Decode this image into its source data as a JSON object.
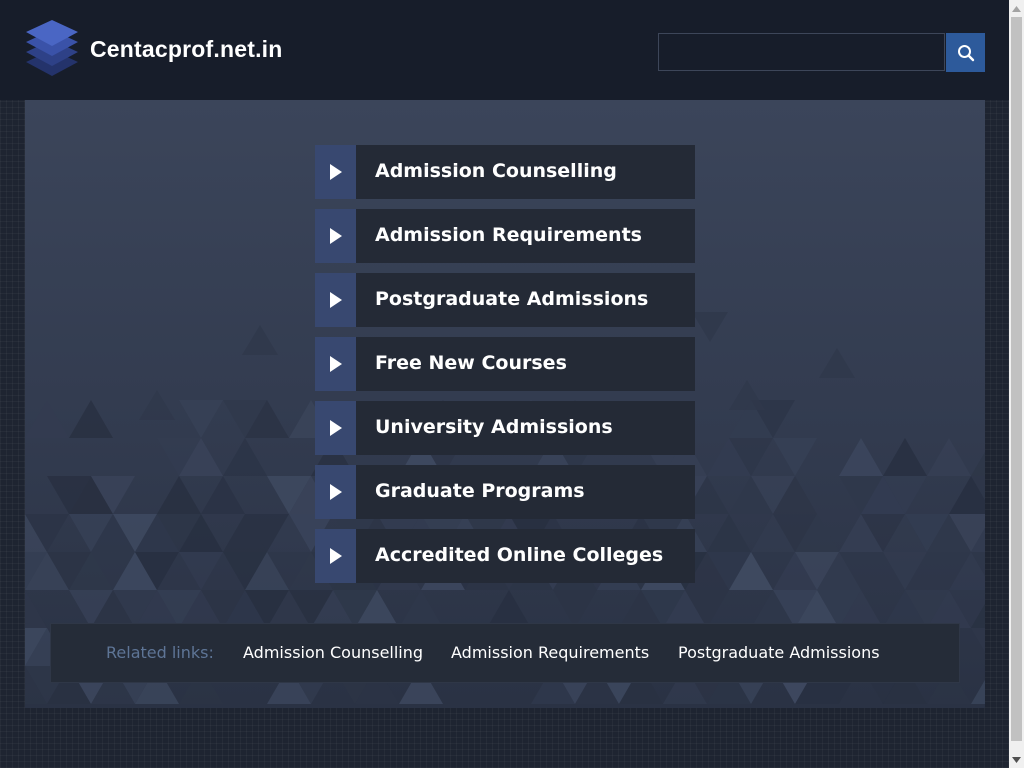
{
  "header": {
    "site_title": "Centacprof.net.in",
    "logo_icon": "stacked-layers-logo-icon",
    "search": {
      "placeholder": "",
      "value": "",
      "button_icon": "search-icon"
    }
  },
  "menu": {
    "arrow_icon": "play-arrow-icon",
    "items": [
      {
        "label": "Admission Counselling"
      },
      {
        "label": "Admission Requirements"
      },
      {
        "label": "Postgraduate Admissions"
      },
      {
        "label": "Free New Courses"
      },
      {
        "label": "University Admissions"
      },
      {
        "label": "Graduate Programs"
      },
      {
        "label": "Accredited Online Colleges"
      }
    ]
  },
  "related": {
    "heading": "Related links:",
    "links": [
      {
        "label": "Admission Counselling"
      },
      {
        "label": "Admission Requirements"
      },
      {
        "label": "Postgraduate Admissions"
      }
    ]
  },
  "colors": {
    "header_bg": "#171d2a",
    "page_bg": "#1e2431",
    "panel_bg": "#3b455a",
    "menu_item_bg": "#242a36",
    "menu_arrow_bg": "#384870",
    "search_button_bg": "#2d5a9b",
    "related_heading": "#5e7596",
    "text": "#ffffff"
  }
}
